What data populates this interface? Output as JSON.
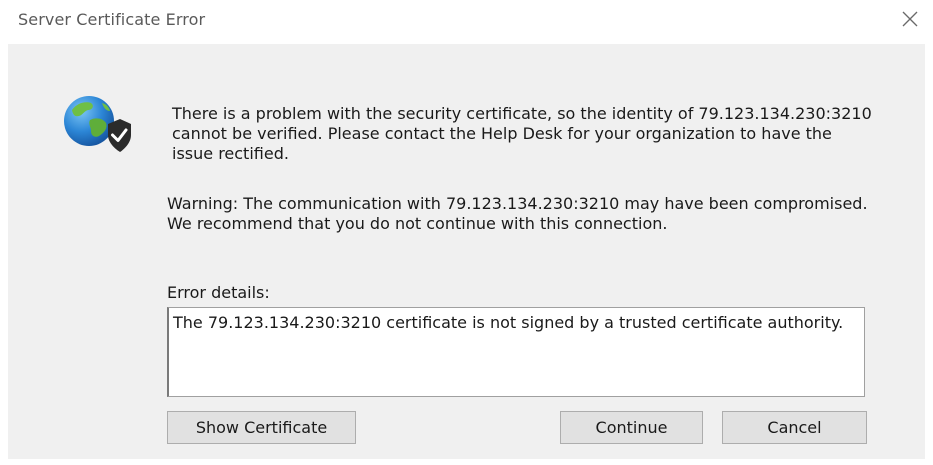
{
  "window": {
    "title": "Server Certificate Error"
  },
  "message": {
    "primary": "There is a problem with the security certificate, so the identity of 79.123.134.230:3210 cannot be verified. Please contact the Help Desk for your organization to have the issue rectified.",
    "warning": "Warning: The communication with 79.123.134.230:3210 may have been compromised. We recommend that you do not continue with this connection."
  },
  "details": {
    "label": "Error details:",
    "text": "The 79.123.134.230:3210 certificate is not signed by a trusted certificate authority."
  },
  "buttons": {
    "show_certificate": "Show Certificate",
    "continue": "Continue",
    "cancel": "Cancel"
  },
  "icons": {
    "close": "close-icon",
    "globe": "globe-shield-icon"
  },
  "colors": {
    "panel_background": "#f0f0f0",
    "button_background": "#e1e1e1",
    "shield": "#2b2b2b"
  }
}
